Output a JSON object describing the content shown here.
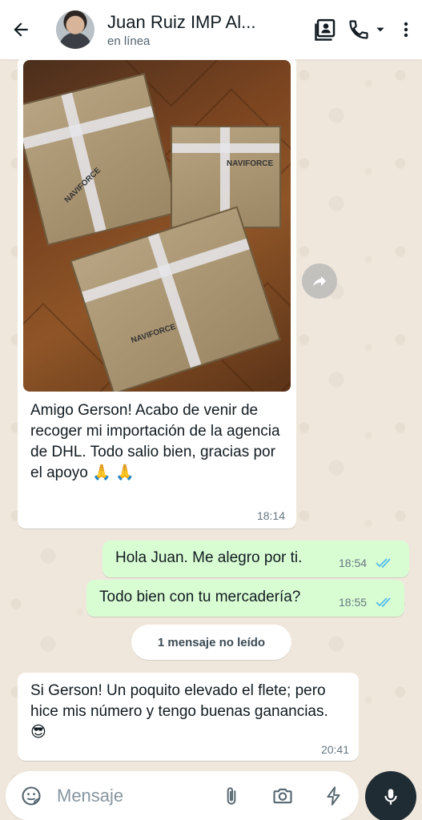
{
  "header": {
    "contact_name": "Juan Ruiz IMP Al...",
    "status": "en línea"
  },
  "messages": [
    {
      "direction": "in",
      "has_photo": true,
      "text": "Amigo Gerson! Acabo de venir de recoger mi importación de la agencia de DHL. Todo salio bien, gracias por el apoyo 🙏 🙏",
      "time": "18:14"
    },
    {
      "direction": "out",
      "text": "Hola Juan. Me alegro por ti.",
      "time": "18:54",
      "status": "read"
    },
    {
      "direction": "out",
      "text": "Todo bien con tu mercadería?",
      "time": "18:55",
      "status": "read"
    },
    {
      "direction": "in",
      "text": "Si Gerson! Un poquito elevado el flete; pero hice mis número y tengo buenas ganancias. 😎",
      "time": "20:41"
    }
  ],
  "unread_banner": "1 mensaje no leído",
  "composer": {
    "placeholder": "Mensaje"
  },
  "photo_box_labels": [
    "NAVIFORCE",
    "NAVIFORCE",
    "NAVIFORCE"
  ],
  "colors": {
    "outgoing_bubble": "#d9fdd3",
    "incoming_bubble": "#ffffff",
    "read_ticks": "#53bdeb",
    "wallpaper": "#efe7dc"
  }
}
